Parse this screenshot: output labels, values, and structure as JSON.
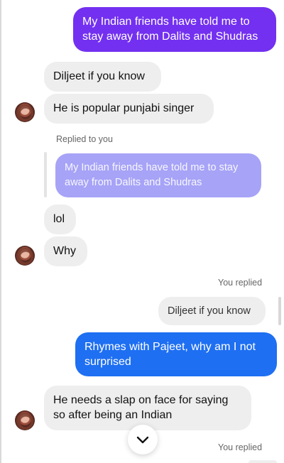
{
  "messages": {
    "m1": "My Indian friends have told me to stay away from Dalits and Shudras",
    "m2": "Diljeet if you know",
    "m3": "He is popular punjabi singer",
    "reply1_label": "Replied to you",
    "m4_quote": "My Indian friends have told me to stay away from Dalits and Shudras",
    "m5": "lol",
    "m6": "Why",
    "reply2_label": "You replied",
    "m7_quote": "Diljeet if you know",
    "m8": "Rhymes with Pajeet, why am I not surprised",
    "m9": "He needs a slap on face for saying so after being an Indian",
    "reply3_label": "You replied"
  },
  "icons": {
    "avatar": "profile-avatar",
    "scroll_down": "chevron-down-icon"
  },
  "colors": {
    "purple_bubble": "#7330f0",
    "blue_bubble": "#1e6ff2",
    "quoted_purple": "#a7a3f7",
    "gray_bubble": "#eeeeee"
  }
}
